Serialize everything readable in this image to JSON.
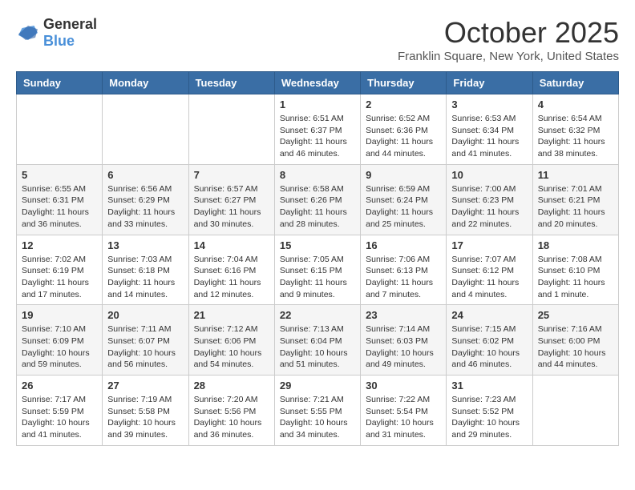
{
  "header": {
    "logo_general": "General",
    "logo_blue": "Blue",
    "month_title": "October 2025",
    "location": "Franklin Square, New York, United States"
  },
  "days_of_week": [
    "Sunday",
    "Monday",
    "Tuesday",
    "Wednesday",
    "Thursday",
    "Friday",
    "Saturday"
  ],
  "weeks": [
    [
      {
        "day": "",
        "info": ""
      },
      {
        "day": "",
        "info": ""
      },
      {
        "day": "",
        "info": ""
      },
      {
        "day": "1",
        "info": "Sunrise: 6:51 AM\nSunset: 6:37 PM\nDaylight: 11 hours and 46 minutes."
      },
      {
        "day": "2",
        "info": "Sunrise: 6:52 AM\nSunset: 6:36 PM\nDaylight: 11 hours and 44 minutes."
      },
      {
        "day": "3",
        "info": "Sunrise: 6:53 AM\nSunset: 6:34 PM\nDaylight: 11 hours and 41 minutes."
      },
      {
        "day": "4",
        "info": "Sunrise: 6:54 AM\nSunset: 6:32 PM\nDaylight: 11 hours and 38 minutes."
      }
    ],
    [
      {
        "day": "5",
        "info": "Sunrise: 6:55 AM\nSunset: 6:31 PM\nDaylight: 11 hours and 36 minutes."
      },
      {
        "day": "6",
        "info": "Sunrise: 6:56 AM\nSunset: 6:29 PM\nDaylight: 11 hours and 33 minutes."
      },
      {
        "day": "7",
        "info": "Sunrise: 6:57 AM\nSunset: 6:27 PM\nDaylight: 11 hours and 30 minutes."
      },
      {
        "day": "8",
        "info": "Sunrise: 6:58 AM\nSunset: 6:26 PM\nDaylight: 11 hours and 28 minutes."
      },
      {
        "day": "9",
        "info": "Sunrise: 6:59 AM\nSunset: 6:24 PM\nDaylight: 11 hours and 25 minutes."
      },
      {
        "day": "10",
        "info": "Sunrise: 7:00 AM\nSunset: 6:23 PM\nDaylight: 11 hours and 22 minutes."
      },
      {
        "day": "11",
        "info": "Sunrise: 7:01 AM\nSunset: 6:21 PM\nDaylight: 11 hours and 20 minutes."
      }
    ],
    [
      {
        "day": "12",
        "info": "Sunrise: 7:02 AM\nSunset: 6:19 PM\nDaylight: 11 hours and 17 minutes."
      },
      {
        "day": "13",
        "info": "Sunrise: 7:03 AM\nSunset: 6:18 PM\nDaylight: 11 hours and 14 minutes."
      },
      {
        "day": "14",
        "info": "Sunrise: 7:04 AM\nSunset: 6:16 PM\nDaylight: 11 hours and 12 minutes."
      },
      {
        "day": "15",
        "info": "Sunrise: 7:05 AM\nSunset: 6:15 PM\nDaylight: 11 hours and 9 minutes."
      },
      {
        "day": "16",
        "info": "Sunrise: 7:06 AM\nSunset: 6:13 PM\nDaylight: 11 hours and 7 minutes."
      },
      {
        "day": "17",
        "info": "Sunrise: 7:07 AM\nSunset: 6:12 PM\nDaylight: 11 hours and 4 minutes."
      },
      {
        "day": "18",
        "info": "Sunrise: 7:08 AM\nSunset: 6:10 PM\nDaylight: 11 hours and 1 minute."
      }
    ],
    [
      {
        "day": "19",
        "info": "Sunrise: 7:10 AM\nSunset: 6:09 PM\nDaylight: 10 hours and 59 minutes."
      },
      {
        "day": "20",
        "info": "Sunrise: 7:11 AM\nSunset: 6:07 PM\nDaylight: 10 hours and 56 minutes."
      },
      {
        "day": "21",
        "info": "Sunrise: 7:12 AM\nSunset: 6:06 PM\nDaylight: 10 hours and 54 minutes."
      },
      {
        "day": "22",
        "info": "Sunrise: 7:13 AM\nSunset: 6:04 PM\nDaylight: 10 hours and 51 minutes."
      },
      {
        "day": "23",
        "info": "Sunrise: 7:14 AM\nSunset: 6:03 PM\nDaylight: 10 hours and 49 minutes."
      },
      {
        "day": "24",
        "info": "Sunrise: 7:15 AM\nSunset: 6:02 PM\nDaylight: 10 hours and 46 minutes."
      },
      {
        "day": "25",
        "info": "Sunrise: 7:16 AM\nSunset: 6:00 PM\nDaylight: 10 hours and 44 minutes."
      }
    ],
    [
      {
        "day": "26",
        "info": "Sunrise: 7:17 AM\nSunset: 5:59 PM\nDaylight: 10 hours and 41 minutes."
      },
      {
        "day": "27",
        "info": "Sunrise: 7:19 AM\nSunset: 5:58 PM\nDaylight: 10 hours and 39 minutes."
      },
      {
        "day": "28",
        "info": "Sunrise: 7:20 AM\nSunset: 5:56 PM\nDaylight: 10 hours and 36 minutes."
      },
      {
        "day": "29",
        "info": "Sunrise: 7:21 AM\nSunset: 5:55 PM\nDaylight: 10 hours and 34 minutes."
      },
      {
        "day": "30",
        "info": "Sunrise: 7:22 AM\nSunset: 5:54 PM\nDaylight: 10 hours and 31 minutes."
      },
      {
        "day": "31",
        "info": "Sunrise: 7:23 AM\nSunset: 5:52 PM\nDaylight: 10 hours and 29 minutes."
      },
      {
        "day": "",
        "info": ""
      }
    ]
  ]
}
